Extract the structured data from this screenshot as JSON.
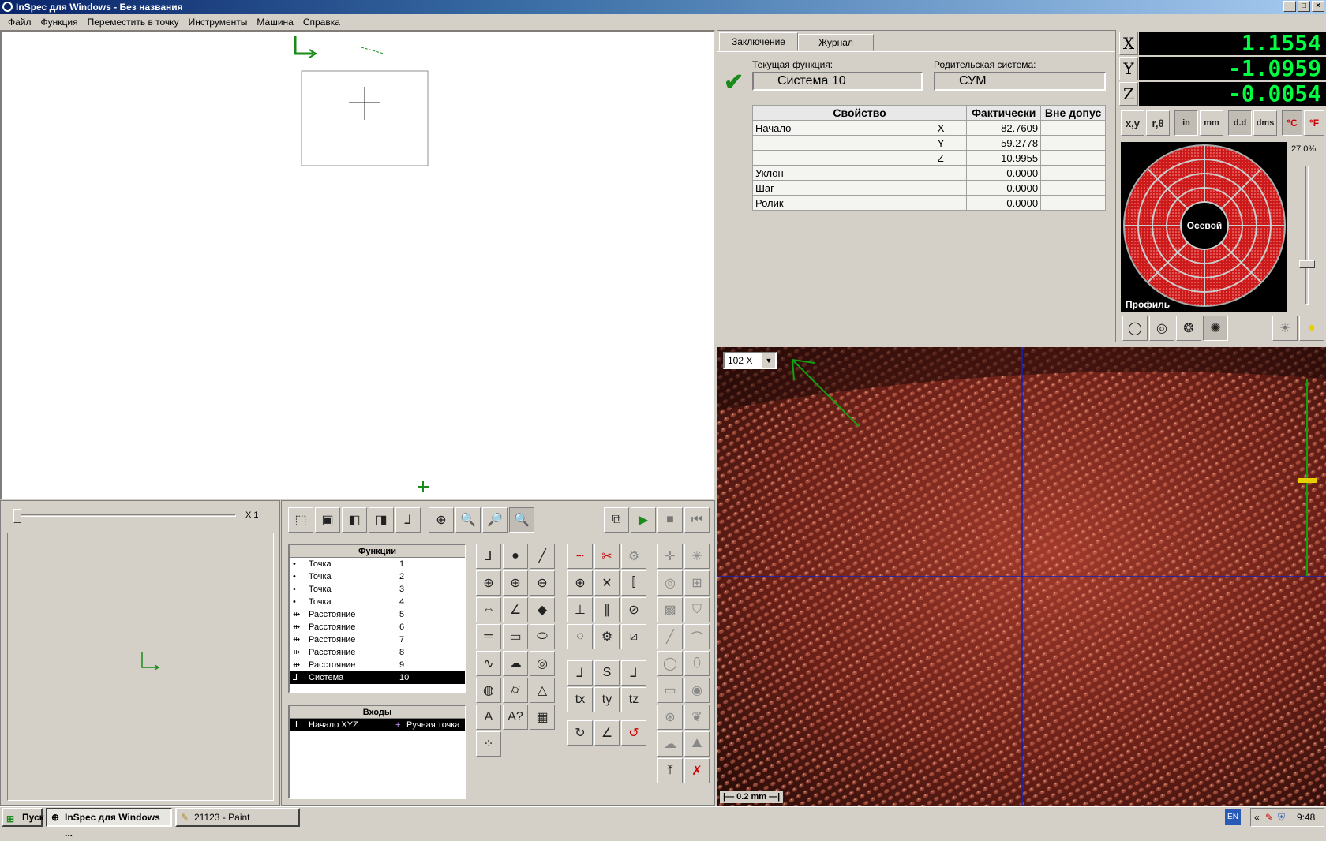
{
  "window": {
    "title": "InSpec для Windows - Без названия"
  },
  "menu": [
    "Файл",
    "Функция",
    "Переместить в точку",
    "Инструменты",
    "Машина",
    "Справка"
  ],
  "left_view": {
    "zoom_label": "X 1"
  },
  "functions": {
    "header": "Функции",
    "items": [
      {
        "name": "Точка",
        "num": "1"
      },
      {
        "name": "Точка",
        "num": "2"
      },
      {
        "name": "Точка",
        "num": "3"
      },
      {
        "name": "Точка",
        "num": "4"
      },
      {
        "name": "Расстояние",
        "num": "5"
      },
      {
        "name": "Расстояние",
        "num": "6"
      },
      {
        "name": "Расстояние",
        "num": "7"
      },
      {
        "name": "Расстояние",
        "num": "8"
      },
      {
        "name": "Расстояние",
        "num": "9"
      },
      {
        "name": "Система",
        "num": "10"
      }
    ]
  },
  "inputs": {
    "header": "Входы",
    "row_left": "Начало XYZ",
    "row_right": "Ручная точка"
  },
  "summary": {
    "tabs": [
      "Заключение",
      "Журнал"
    ],
    "current_label": "Текущая функция:",
    "current_value": "Система  10",
    "parent_label": "Родительская система:",
    "parent_value": "СУМ",
    "columns": [
      "Свойство",
      "Фактически",
      "Вне допус"
    ],
    "rows": [
      {
        "prop": "Начало",
        "axis": "X",
        "value": "82.7609"
      },
      {
        "prop": "",
        "axis": "Y",
        "value": "59.2778"
      },
      {
        "prop": "",
        "axis": "Z",
        "value": "10.9955"
      },
      {
        "prop": "Уклон",
        "axis": "",
        "value": "0.0000"
      },
      {
        "prop": "Шаг",
        "axis": "",
        "value": "0.0000"
      },
      {
        "prop": "Ролик",
        "axis": "",
        "value": "0.0000"
      }
    ]
  },
  "dro": {
    "x_label": "X",
    "y_label": "Y",
    "z_label": "Z",
    "x": "1.1554",
    "y": "-1.0959",
    "z": "-0.0054"
  },
  "unit_buttons": [
    "x,y",
    "r,θ",
    "in",
    "mm",
    "d.d",
    "dms",
    "°C",
    "°F"
  ],
  "light": {
    "percent": "27.0%",
    "center_label": "Осевой",
    "bottom_label": "Профиль",
    "ring_color": "#cc1a1a"
  },
  "camera": {
    "zoom": "102 X",
    "scale": "0.2 mm"
  },
  "taskbar": {
    "start": "Пуск",
    "task1": "InSpec для Windows ...",
    "task2": "21123 - Paint",
    "lang": "EN",
    "time": "9:48"
  }
}
